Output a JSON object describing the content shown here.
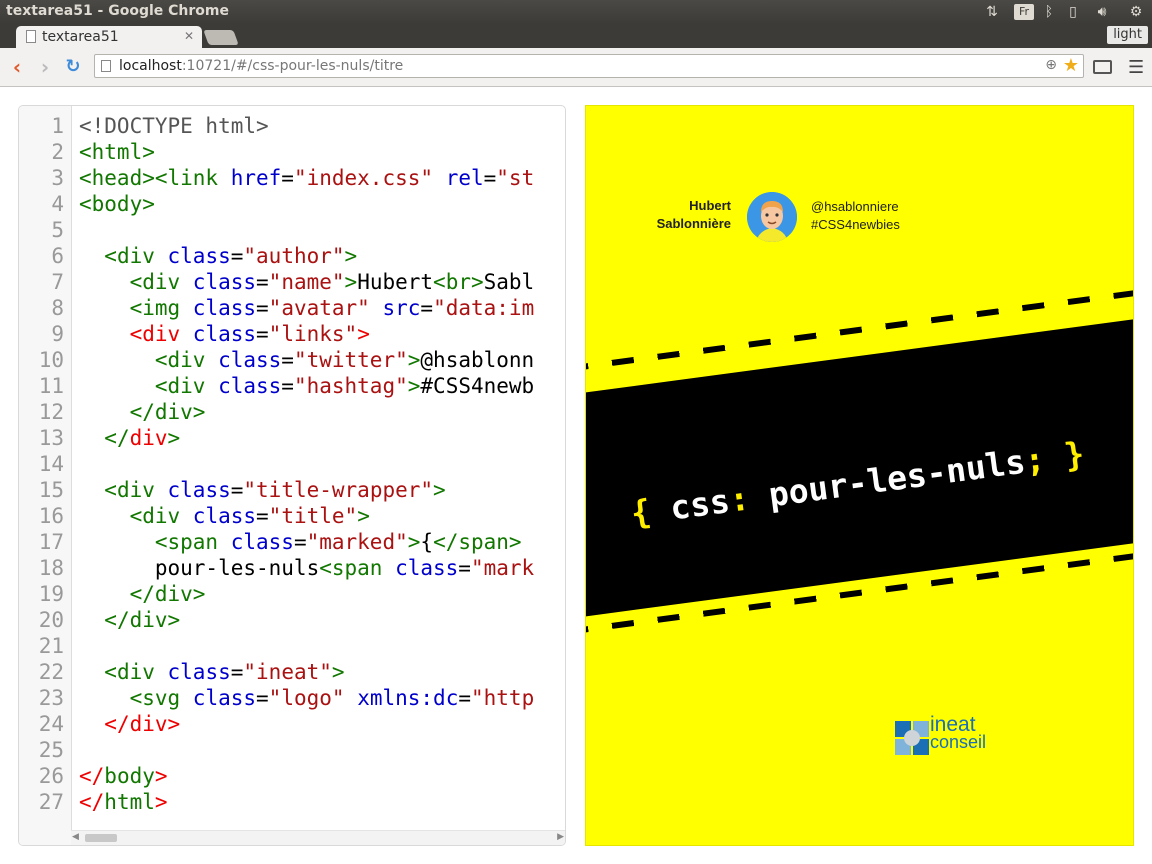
{
  "window": {
    "title": "textarea51 - Google Chrome"
  },
  "system_tray": {
    "keyboard_layout": "Fr"
  },
  "tab": {
    "title": "textarea51"
  },
  "profile": {
    "label": "light"
  },
  "address": {
    "host": "localhost",
    "path": ":10721/#/css-pour-les-nuls/titre"
  },
  "editor": {
    "line_numbers": [
      "1",
      "2",
      "3",
      "4",
      "5",
      "6",
      "7",
      "8",
      "9",
      "10",
      "11",
      "12",
      "13",
      "14",
      "15",
      "16",
      "17",
      "18",
      "19",
      "20",
      "21",
      "22",
      "23",
      "24",
      "25",
      "26",
      "27"
    ],
    "lines": [
      [
        {
          "c": "kw",
          "t": "<!DOCTYPE html>"
        }
      ],
      [
        {
          "c": "tag",
          "t": "<html>"
        }
      ],
      [
        {
          "c": "tag",
          "t": "<head><link "
        },
        {
          "c": "attr",
          "t": "href"
        },
        {
          "c": "txt",
          "t": "="
        },
        {
          "c": "str",
          "t": "\"index.css\""
        },
        {
          "c": "txt",
          "t": " "
        },
        {
          "c": "attr",
          "t": "rel"
        },
        {
          "c": "txt",
          "t": "="
        },
        {
          "c": "str",
          "t": "\"st"
        }
      ],
      [
        {
          "c": "tag",
          "t": "<body>"
        }
      ],
      [],
      [
        {
          "c": "txt",
          "t": "  "
        },
        {
          "c": "tag",
          "t": "<div "
        },
        {
          "c": "attr",
          "t": "class"
        },
        {
          "c": "txt",
          "t": "="
        },
        {
          "c": "str",
          "t": "\"author\""
        },
        {
          "c": "tag",
          "t": ">"
        }
      ],
      [
        {
          "c": "txt",
          "t": "    "
        },
        {
          "c": "tag",
          "t": "<div "
        },
        {
          "c": "attr",
          "t": "class"
        },
        {
          "c": "txt",
          "t": "="
        },
        {
          "c": "str",
          "t": "\"name\""
        },
        {
          "c": "tag",
          "t": ">"
        },
        {
          "c": "txt",
          "t": "Hubert"
        },
        {
          "c": "tag",
          "t": "<br>"
        },
        {
          "c": "txt",
          "t": "Sabl"
        }
      ],
      [
        {
          "c": "txt",
          "t": "    "
        },
        {
          "c": "tag",
          "t": "<img "
        },
        {
          "c": "attr",
          "t": "class"
        },
        {
          "c": "txt",
          "t": "="
        },
        {
          "c": "str",
          "t": "\"avatar\""
        },
        {
          "c": "txt",
          "t": " "
        },
        {
          "c": "attr",
          "t": "src"
        },
        {
          "c": "txt",
          "t": "="
        },
        {
          "c": "str",
          "t": "\"data:im"
        }
      ],
      [
        {
          "c": "txt",
          "t": "    "
        },
        {
          "c": "err",
          "t": "<div "
        },
        {
          "c": "attr",
          "t": "class"
        },
        {
          "c": "txt",
          "t": "="
        },
        {
          "c": "str",
          "t": "\"links\""
        },
        {
          "c": "err",
          "t": ">"
        }
      ],
      [
        {
          "c": "txt",
          "t": "      "
        },
        {
          "c": "tag",
          "t": "<div "
        },
        {
          "c": "attr",
          "t": "class"
        },
        {
          "c": "txt",
          "t": "="
        },
        {
          "c": "str",
          "t": "\"twitter\""
        },
        {
          "c": "tag",
          "t": ">"
        },
        {
          "c": "txt",
          "t": "@hsablonn"
        }
      ],
      [
        {
          "c": "txt",
          "t": "      "
        },
        {
          "c": "tag",
          "t": "<div "
        },
        {
          "c": "attr",
          "t": "class"
        },
        {
          "c": "txt",
          "t": "="
        },
        {
          "c": "str",
          "t": "\"hashtag\""
        },
        {
          "c": "tag",
          "t": ">"
        },
        {
          "c": "txt",
          "t": "#CSS4newb"
        }
      ],
      [
        {
          "c": "txt",
          "t": "    "
        },
        {
          "c": "tag",
          "t": "</div>"
        }
      ],
      [
        {
          "c": "txt",
          "t": "  "
        },
        {
          "c": "tag",
          "t": "</"
        },
        {
          "c": "err",
          "t": "div"
        },
        {
          "c": "tag",
          "t": ">"
        }
      ],
      [],
      [
        {
          "c": "txt",
          "t": "  "
        },
        {
          "c": "tag",
          "t": "<div "
        },
        {
          "c": "attr",
          "t": "class"
        },
        {
          "c": "txt",
          "t": "="
        },
        {
          "c": "str",
          "t": "\"title-wrapper\""
        },
        {
          "c": "tag",
          "t": ">"
        }
      ],
      [
        {
          "c": "txt",
          "t": "    "
        },
        {
          "c": "tag",
          "t": "<div "
        },
        {
          "c": "attr",
          "t": "class"
        },
        {
          "c": "txt",
          "t": "="
        },
        {
          "c": "str",
          "t": "\"title\""
        },
        {
          "c": "tag",
          "t": ">"
        }
      ],
      [
        {
          "c": "txt",
          "t": "      "
        },
        {
          "c": "tag",
          "t": "<span "
        },
        {
          "c": "attr",
          "t": "class"
        },
        {
          "c": "txt",
          "t": "="
        },
        {
          "c": "str",
          "t": "\"marked\""
        },
        {
          "c": "tag",
          "t": ">"
        },
        {
          "c": "txt",
          "t": "{"
        },
        {
          "c": "tag",
          "t": "</span>"
        }
      ],
      [
        {
          "c": "txt",
          "t": "      pour-les-nuls"
        },
        {
          "c": "tag",
          "t": "<span "
        },
        {
          "c": "attr",
          "t": "class"
        },
        {
          "c": "txt",
          "t": "="
        },
        {
          "c": "str",
          "t": "\"mark"
        }
      ],
      [
        {
          "c": "txt",
          "t": "    "
        },
        {
          "c": "tag",
          "t": "</div>"
        }
      ],
      [
        {
          "c": "txt",
          "t": "  "
        },
        {
          "c": "tag",
          "t": "</div>"
        }
      ],
      [],
      [
        {
          "c": "txt",
          "t": "  "
        },
        {
          "c": "tag",
          "t": "<div "
        },
        {
          "c": "attr",
          "t": "class"
        },
        {
          "c": "txt",
          "t": "="
        },
        {
          "c": "str",
          "t": "\"ineat\""
        },
        {
          "c": "tag",
          "t": ">"
        }
      ],
      [
        {
          "c": "txt",
          "t": "    "
        },
        {
          "c": "tag",
          "t": "<svg "
        },
        {
          "c": "attr",
          "t": "class"
        },
        {
          "c": "txt",
          "t": "="
        },
        {
          "c": "str",
          "t": "\"logo\""
        },
        {
          "c": "txt",
          "t": " "
        },
        {
          "c": "attr",
          "t": "xmlns:dc"
        },
        {
          "c": "txt",
          "t": "="
        },
        {
          "c": "str",
          "t": "\"http"
        }
      ],
      [
        {
          "c": "txt",
          "t": "  "
        },
        {
          "c": "err",
          "t": "</div>"
        }
      ],
      [],
      [
        {
          "c": "err",
          "t": "</"
        },
        {
          "c": "tag",
          "t": "body"
        },
        {
          "c": "err",
          "t": ">"
        }
      ],
      [
        {
          "c": "err",
          "t": "</"
        },
        {
          "c": "tag",
          "t": "html"
        },
        {
          "c": "err",
          "t": ">"
        }
      ]
    ]
  },
  "preview": {
    "author_first": "Hubert",
    "author_last": "Sablonnière",
    "twitter": "@hsablonniere",
    "hashtag": "#CSS4newbies",
    "title_open": "{",
    "title_main": " css",
    "title_colon": ":",
    "title_rest": " pour-les-nuls",
    "title_semicolon": ";",
    "title_close": " }",
    "logo_word1": "ineat",
    "logo_word2": "conseil",
    "background_color": "#ffff00",
    "band_color": "#000000",
    "accent_color": "#ffee00"
  },
  "icons": [
    "back-arrow-icon",
    "forward-arrow-icon",
    "reload-icon",
    "page-icon",
    "zoom-icon",
    "star-icon",
    "cast-icon",
    "menu-icon",
    "network-icon",
    "bluetooth-icon",
    "battery-icon",
    "volume-icon",
    "settings-icon",
    "avatar-icon",
    "logo-icon"
  ]
}
